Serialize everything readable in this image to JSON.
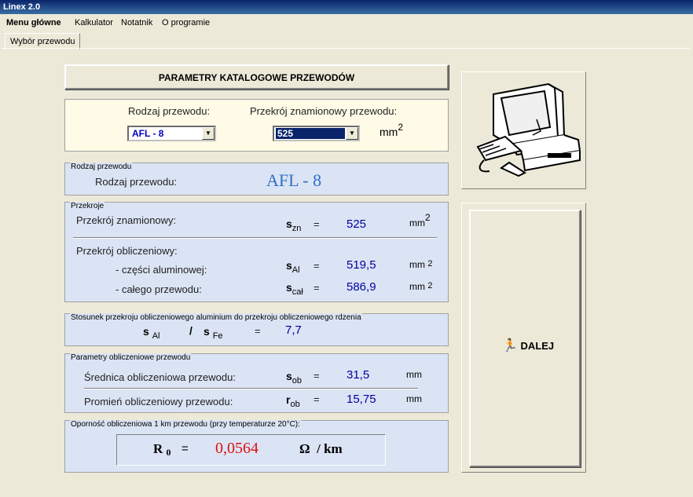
{
  "window": {
    "title": "Linex 2.0"
  },
  "menu": {
    "items": [
      "Menu główne",
      "Kalkulator",
      "Notatnik",
      "O programie"
    ]
  },
  "tabs": {
    "active": "Wybór przewodu"
  },
  "header": {
    "title": "PARAMETRY   KATALOGOWE PRZEWODÓW"
  },
  "selection": {
    "type_label": "Rodzaj przewodu:",
    "type_value": "AFL - 8",
    "section_label": "Przekrój znamionowy przewodu:",
    "section_value": "525",
    "unit": "mm",
    "unit_exp": "2"
  },
  "rodzaj": {
    "group": "Rodzaj przewodu",
    "label": "Rodzaj przewodu:",
    "value": "AFL - 8"
  },
  "przekroje": {
    "group": "Przekroje",
    "znam_label": "Przekrój znamionowy:",
    "znam_sym": "s",
    "znam_sub": "zn",
    "znam_value": "525",
    "oblicz_label": "Przekrój obliczeniowy:",
    "al_label": "- części aluminowej:",
    "al_sym": "s",
    "al_sub": "Al",
    "al_value": "519,5",
    "cal_label": "- całego przewodu:",
    "cal_sym": "s",
    "cal_sub": "cał",
    "cal_value": "586,9",
    "eq": "=",
    "unit": "mm",
    "unit_exp": "2"
  },
  "stosunek": {
    "group": "Stosunek przekroju obliczeniowego aluminium do przekroju obliczeniowego rdzenia",
    "sym1": "s",
    "sub1": "Al",
    "slash": "/",
    "sym2": "s",
    "sub2": "Fe",
    "eq": "=",
    "value": "7,7"
  },
  "parametry": {
    "group": "Parametry obliczeniowe przewodu",
    "srednica_label": "Średnica obliczeniowa przewodu:",
    "srednica_sym": "s",
    "srednica_sub": "ob",
    "srednica_value": "31,5",
    "promien_label": "Promień obliczeniowy przewodu:",
    "promien_sym": "r",
    "promien_sub": "ob",
    "promien_value": "15,75",
    "eq": "=",
    "unit": "mm"
  },
  "opornosc": {
    "group": "Oporność obliczeniowa 1 km przewodu (przy temperaturze 20°C):",
    "sym": "R",
    "sub": "0",
    "eq": "=",
    "value": "0,0564",
    "unit_symbol": "Ω",
    "unit_rest": "/ km"
  },
  "actions": {
    "next_label": "DALEJ",
    "next_icon": "running-man-icon"
  },
  "image": {
    "name": "computer-illustration"
  }
}
